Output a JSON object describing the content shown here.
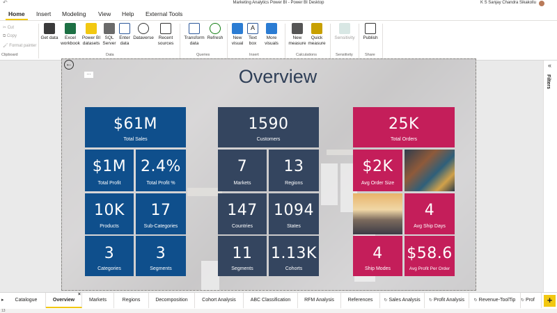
{
  "window": {
    "title": "Marketing Analytics Power BI - Power BI Desktop",
    "user": "K S Sanjay Chandra Sikakollu"
  },
  "menu": {
    "tabs": [
      "Home",
      "Insert",
      "Modeling",
      "View",
      "Help",
      "External Tools"
    ],
    "active": "Home"
  },
  "ribbon": {
    "clipboard": {
      "cut": "Cut",
      "copy": "Copy",
      "format_painter": "Format painter",
      "group": "Clipboard"
    },
    "data": {
      "get_data": "Get data",
      "excel": "Excel workbook",
      "pbi_datasets": "Power BI datasets",
      "sql": "SQL Server",
      "enter_data": "Enter data",
      "dataverse": "Dataverse",
      "recent": "Recent sources",
      "group": "Data"
    },
    "queries": {
      "transform": "Transform data",
      "refresh": "Refresh",
      "group": "Queries"
    },
    "insert": {
      "new_visual": "New visual",
      "text_box": "Text box",
      "more_visuals": "More visuals",
      "group": "Insert"
    },
    "calculations": {
      "new_measure": "New measure",
      "quick_measure": "Quick measure",
      "group": "Calculations"
    },
    "sensitivity": {
      "label": "Sensitivity",
      "group": "Sensitivity"
    },
    "share": {
      "publish": "Publish",
      "group": "Share"
    }
  },
  "report": {
    "title": "Overview",
    "sales": {
      "total_sales": {
        "value": "$61M",
        "label": "Total Sales"
      },
      "total_profit": {
        "value": "$1M",
        "label": "Total Profit"
      },
      "total_profit_pct": {
        "value": "2.4%",
        "label": "Total Profit %"
      },
      "products": {
        "value": "10K",
        "label": "Products"
      },
      "sub_categories": {
        "value": "17",
        "label": "Sub-Categories"
      },
      "categories": {
        "value": "3",
        "label": "Categories"
      },
      "segments": {
        "value": "3",
        "label": "Segments"
      }
    },
    "customers": {
      "customers": {
        "value": "1590",
        "label": "Customers"
      },
      "markets": {
        "value": "7",
        "label": "Markets"
      },
      "regions": {
        "value": "13",
        "label": "Regions"
      },
      "countries": {
        "value": "147",
        "label": "Countries"
      },
      "states": {
        "value": "1094",
        "label": "States"
      },
      "segments": {
        "value": "11",
        "label": "Segments"
      },
      "cohorts": {
        "value": "1.13K",
        "label": "Cohorts"
      }
    },
    "orders": {
      "total_orders": {
        "value": "25K",
        "label": "Total Orders"
      },
      "avg_order_size": {
        "value": "$2K",
        "label": "Avg Order Size"
      },
      "avg_ship_days": {
        "value": "4",
        "label": "Avg Ship Days"
      },
      "ship_modes": {
        "value": "4",
        "label": "Ship Modes"
      },
      "avg_profit_per_order": {
        "value": "$58.6",
        "label": "Avg Profit Per Order"
      }
    }
  },
  "filters_pane": {
    "label": "Filters"
  },
  "pages": {
    "tabs": [
      "Catalogue",
      "Overview",
      "Markets",
      "Regions",
      "Decomposition",
      "Cohort Analysis",
      "ABC Classification",
      "RFM Analysis",
      "References",
      "Sales Analysis",
      "Profit Analysis",
      "Revenue-ToolTip",
      "Prof"
    ],
    "active": "Overview",
    "add": "+"
  },
  "colors": {
    "blue": "#0f4f8c",
    "navy": "#34455f",
    "red": "#c41e5a",
    "accent": "#f2c811"
  },
  "status": {
    "text": "13"
  }
}
